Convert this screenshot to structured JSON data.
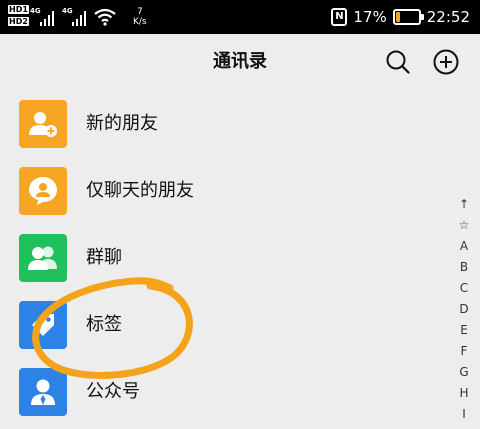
{
  "status_bar": {
    "sim1": "HD1",
    "sim2": "HD2",
    "net1": "4G",
    "net2": "4G",
    "speed_value": "7",
    "speed_unit": "K/s",
    "nfc": "N",
    "battery_percent": "17%",
    "battery_level": 0.17,
    "time": "22:52"
  },
  "header": {
    "title": "通讯录",
    "search_icon": "search-icon",
    "add_icon": "plus-circle-icon"
  },
  "list": [
    {
      "label": "新的朋友",
      "icon": "add-person-icon",
      "color": "#f6a623"
    },
    {
      "label": "仅聊天的朋友",
      "icon": "chat-bubble-person-icon",
      "color": "#f6a623"
    },
    {
      "label": "群聊",
      "icon": "group-icon",
      "color": "#20c05c"
    },
    {
      "label": "标签",
      "icon": "tag-icon",
      "color": "#2d82e6"
    },
    {
      "label": "公众号",
      "icon": "official-account-icon",
      "color": "#2d82e6"
    }
  ],
  "index_bar": [
    "↑",
    "☆",
    "A",
    "B",
    "C",
    "D",
    "E",
    "F",
    "G",
    "H",
    "I"
  ],
  "annotation_color": "#f5a31a"
}
